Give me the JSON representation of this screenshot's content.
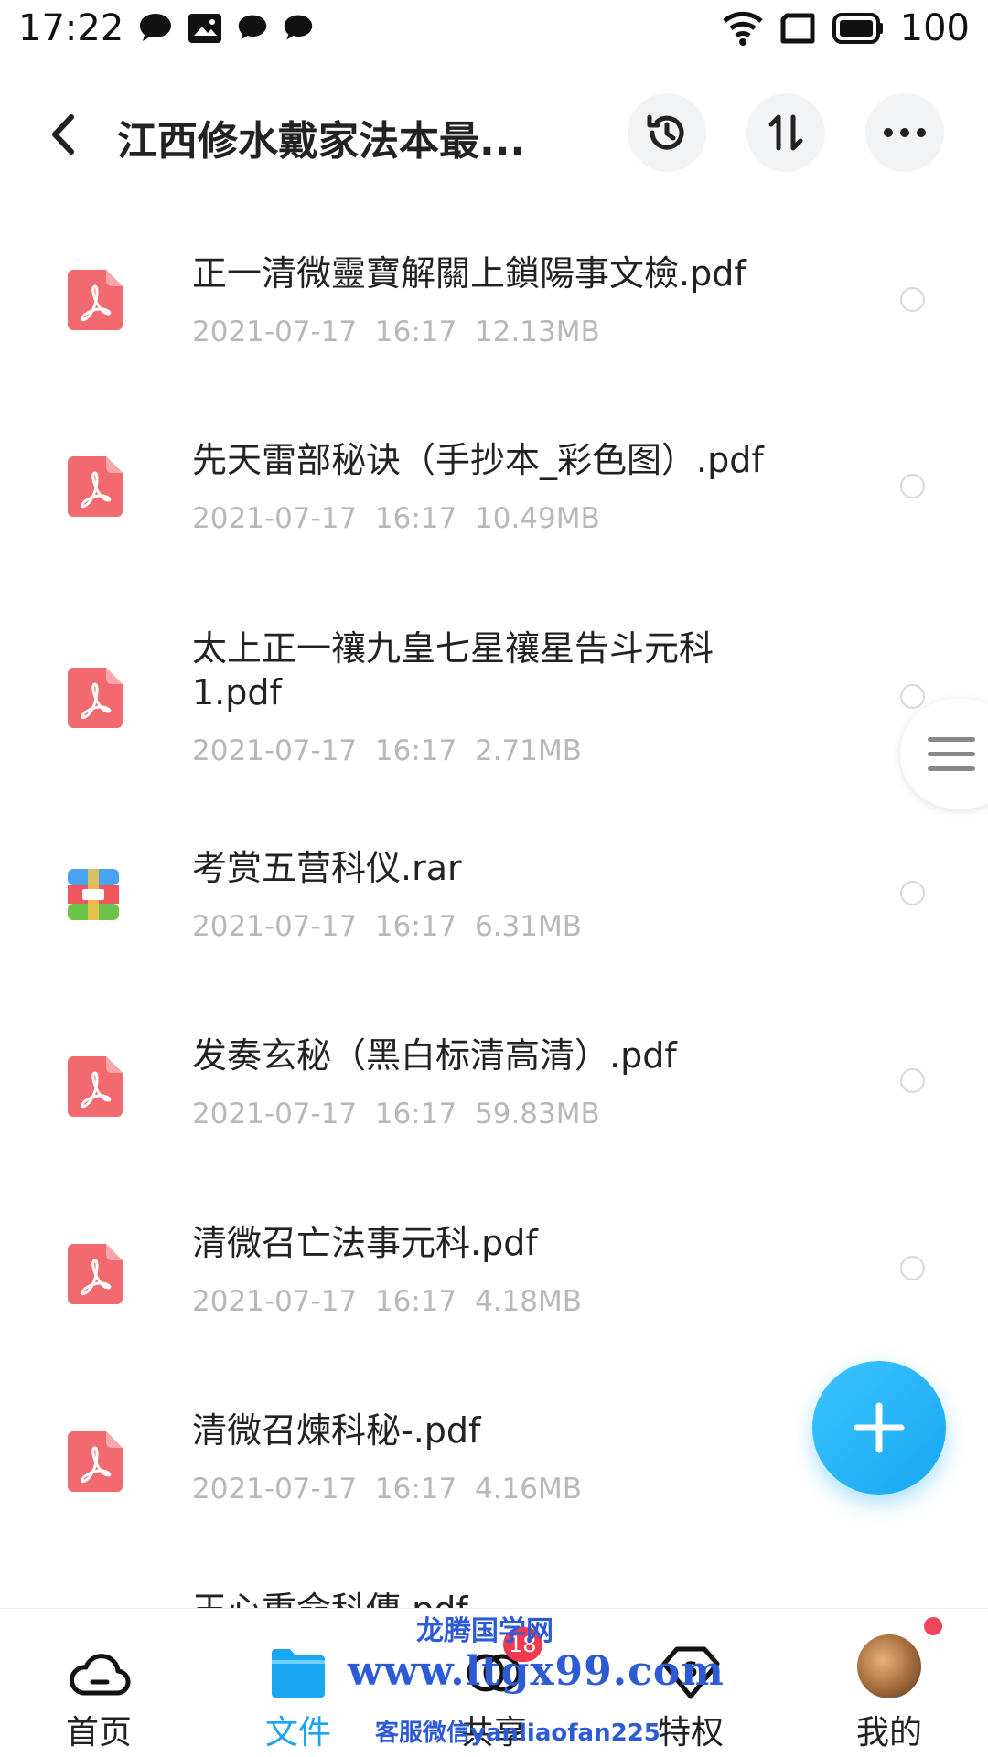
{
  "status_bar": {
    "time": "17:22",
    "battery": "100",
    "notification_icons": [
      "chat-bubble-icon",
      "image-icon",
      "chat-bubble-icon",
      "chat-bubble-icon"
    ]
  },
  "header": {
    "title": "江西修水戴家法本最..."
  },
  "files": [
    {
      "name": "正一清微靈寶解關上鎖陽事文檢.pdf",
      "date": "2021-07-17",
      "time": "16:17",
      "size": "12.13MB",
      "type": "pdf"
    },
    {
      "name": "先天雷部秘诀（手抄本_彩色图）.pdf",
      "date": "2021-07-17",
      "time": "16:17",
      "size": "10.49MB",
      "type": "pdf"
    },
    {
      "name_line1": "太上正一禳九皇七星禳星告斗元科",
      "name_line2": "1.pdf",
      "date": "2021-07-17",
      "time": "16:17",
      "size": "2.71MB",
      "type": "pdf"
    },
    {
      "name": "考赏五营科仪.rar",
      "date": "2021-07-17",
      "time": "16:17",
      "size": "6.31MB",
      "type": "rar"
    },
    {
      "name": "发奏玄秘（黑白标清高清）.pdf",
      "date": "2021-07-17",
      "time": "16:17",
      "size": "59.83MB",
      "type": "pdf"
    },
    {
      "name": "清微召亡法事元科.pdf",
      "date": "2021-07-17",
      "time": "16:17",
      "size": "4.18MB",
      "type": "pdf"
    },
    {
      "name": "清微召煉科秘-.pdf",
      "date": "2021-07-17",
      "time": "16:17",
      "size": "4.16MB",
      "type": "pdf"
    }
  ],
  "partial_file_name": "王心重命科傳.pdf",
  "bottom_nav": {
    "items": [
      {
        "label": "首页",
        "icon": "cloud-icon"
      },
      {
        "label": "文件",
        "icon": "folder-icon",
        "active": true
      },
      {
        "label": "共享",
        "icon": "share-icon",
        "badge": "18"
      },
      {
        "label": "特权",
        "icon": "privilege-icon"
      },
      {
        "label": "我的",
        "icon": "avatar"
      }
    ]
  },
  "watermark": {
    "line1": "龙腾国学网",
    "line2": "www.ltgx99.com",
    "line3": "客服微信yanliaofan225"
  },
  "colors": {
    "accent": "#19a7f1",
    "pdf_icon": "#f06a6f",
    "badge": "#f03b4e",
    "meta_text": "#b8b8b8"
  }
}
